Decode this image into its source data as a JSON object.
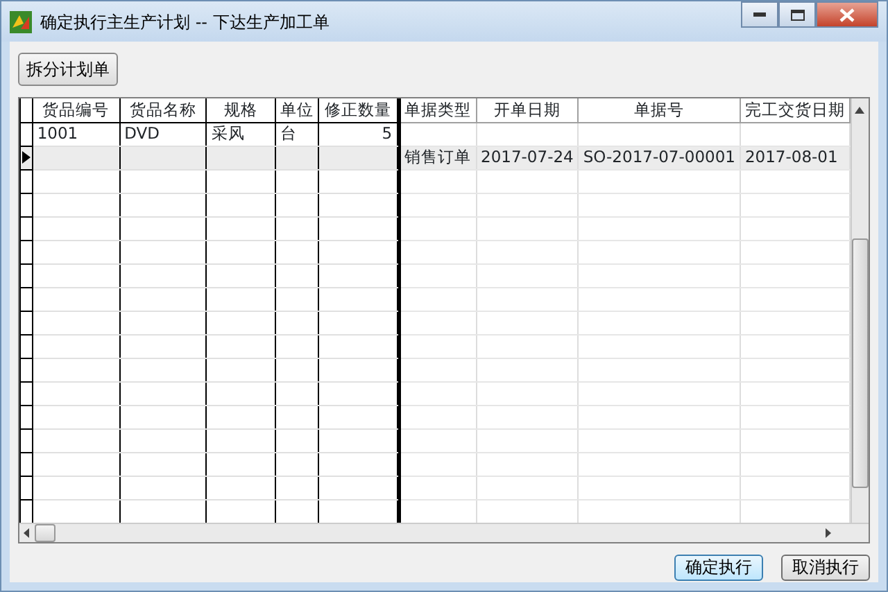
{
  "window": {
    "title": "确定执行主生产计划  -- 下达生产加工单"
  },
  "toolbar": {
    "button": "拆分计划单"
  },
  "left_grid": {
    "columns": [
      {
        "label": "货品编号"
      },
      {
        "label": "货品名称"
      },
      {
        "label": "规格"
      },
      {
        "label": "单位"
      },
      {
        "label": "修正数量",
        "kind": "number"
      }
    ],
    "rows": [
      {
        "selected": false,
        "cells": [
          "1001",
          "DVD",
          "采风",
          "台",
          "5"
        ]
      },
      {
        "selected": true
      }
    ]
  },
  "right_grid": {
    "columns": [
      {
        "label": "单据类型"
      },
      {
        "label": "开单日期"
      },
      {
        "label": "单据号"
      },
      {
        "label": "完工交货日期"
      }
    ],
    "rows": [
      {
        "selected": false
      },
      {
        "selected": true,
        "cells": [
          "销售订单",
          "2017-07-24",
          "SO-2017-07-00001",
          "2017-08-01"
        ]
      }
    ]
  },
  "buttons": [
    {
      "label": "确定执行",
      "default": true
    },
    {
      "label": "取消执行",
      "default": false
    }
  ]
}
